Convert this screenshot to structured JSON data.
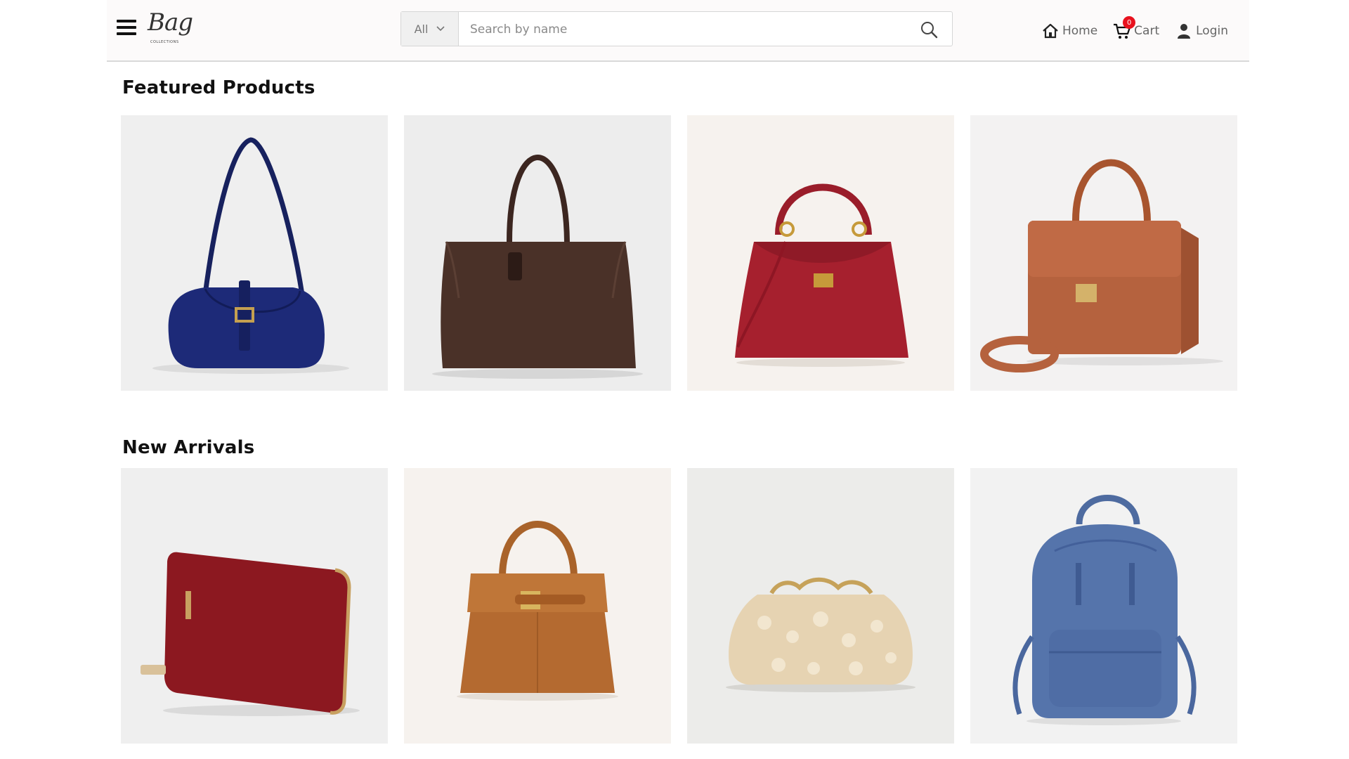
{
  "header": {
    "logo_text": "Bag",
    "logo_sub": "COLLECTIONS",
    "search": {
      "category": "All",
      "placeholder": "Search by name"
    },
    "nav": {
      "home_label": "Home",
      "cart_label": "Cart",
      "cart_count": "0",
      "login_label": "Login"
    }
  },
  "sections": [
    {
      "title": "Featured Products",
      "products": [
        {
          "icon": "blue-shoulder-bag",
          "color": "#1d2a78",
          "bg": "#efefef"
        },
        {
          "icon": "brown-tote-bag",
          "color": "#4a3128",
          "bg": "#ededed"
        },
        {
          "icon": "red-top-handle-bag",
          "color": "#a6202e",
          "bg": "#f6f2ee"
        },
        {
          "icon": "tan-satchel-bag",
          "color": "#b5623e",
          "bg": "#f3f2f2"
        }
      ]
    },
    {
      "title": "New Arrivals",
      "products": [
        {
          "icon": "red-zip-wallet",
          "color": "#8c1820",
          "bg": "#efefef"
        },
        {
          "icon": "tan-kelly-bag",
          "color": "#b46a30",
          "bg": "#f6f2ee"
        },
        {
          "icon": "sequin-clutch",
          "color": "#e6d3b2",
          "bg": "#ececea"
        },
        {
          "icon": "blue-backpack",
          "color": "#5574ab",
          "bg": "#f2f2f2"
        }
      ]
    }
  ]
}
